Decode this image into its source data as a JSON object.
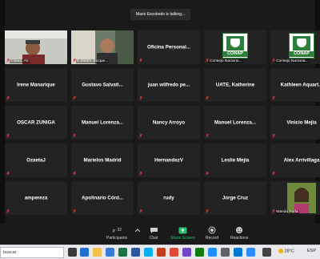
{
  "talking_banner": "Mario Escobedo is talking...",
  "tiles": [
    {
      "name": "",
      "label": "Coban, AV.",
      "type": "video1"
    },
    {
      "name": "",
      "label": "D.Madre Jacque...",
      "type": "video2"
    },
    {
      "name": "Oficina Personal...",
      "label": "",
      "type": "name"
    },
    {
      "name": "",
      "label": "Consejo Naciona...",
      "type": "conap"
    },
    {
      "name": "",
      "label": "Consejo Naciona...",
      "type": "conap"
    },
    {
      "name": "Irene Manarique",
      "label": "",
      "type": "name"
    },
    {
      "name": "Gustavo Salvati...",
      "label": "",
      "type": "name"
    },
    {
      "name": "juan wilfredo pe...",
      "label": "",
      "type": "name"
    },
    {
      "name": "UATE, Katherine",
      "label": "",
      "type": "name"
    },
    {
      "name": "Kathleen Aquart...",
      "label": "",
      "type": "name"
    },
    {
      "name": "OSCAR ZUÑIGA",
      "label": "",
      "type": "name"
    },
    {
      "name": "Manuel Lorenza...",
      "label": "",
      "type": "name"
    },
    {
      "name": "Nancy Arroyo",
      "label": "",
      "type": "name"
    },
    {
      "name": "Manuel Lorenza...",
      "label": "",
      "type": "name"
    },
    {
      "name": "Vinicio Mejia",
      "label": "",
      "type": "name"
    },
    {
      "name": "OzaetaJ",
      "label": "",
      "type": "name"
    },
    {
      "name": "Marielos Madrid",
      "label": "",
      "type": "name"
    },
    {
      "name": "HernandezV",
      "label": "",
      "type": "name"
    },
    {
      "name": "Leslie Mejia",
      "label": "",
      "type": "name"
    },
    {
      "name": "Alex Arrivillaga",
      "label": "",
      "type": "name"
    },
    {
      "name": "ampereza",
      "label": "",
      "type": "name"
    },
    {
      "name": "Apolinario Córd...",
      "label": "",
      "type": "name"
    },
    {
      "name": "rudy",
      "label": "",
      "type": "name"
    },
    {
      "name": "Jorge Cruz",
      "label": "",
      "type": "name"
    },
    {
      "name": "",
      "label": "Wanda Perla",
      "type": "video3"
    }
  ],
  "conap_text": "CONAP",
  "toolbar": {
    "participants_label": "Participants",
    "participants_count": "32",
    "chat_label": "Chat",
    "share_label": "Share Screen",
    "record_label": "Record",
    "reactions_label": "Reactions"
  },
  "taskbar": {
    "search_placeholder": "buscar",
    "temperature": "28°C",
    "language": "ESP"
  },
  "colors": {
    "share_green": "#26c26a",
    "mic_red": "#e5383b",
    "tile_bg": "#232323",
    "conap_green": "#2d7f3a"
  }
}
